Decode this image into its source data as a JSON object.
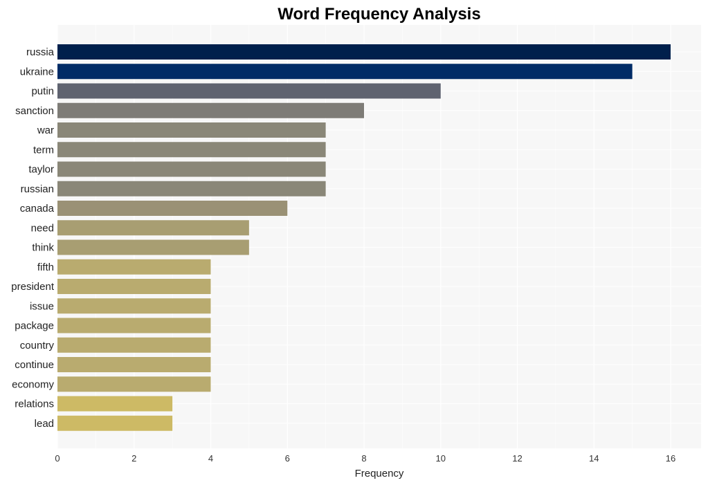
{
  "chart_data": {
    "type": "bar",
    "orientation": "horizontal",
    "title": "Word Frequency Analysis",
    "xlabel": "Frequency",
    "ylabel": "",
    "xlim": [
      0,
      16.8
    ],
    "xticks": [
      0,
      2,
      4,
      6,
      8,
      10,
      12,
      14,
      16
    ],
    "grid": true,
    "legend": "none",
    "categories": [
      "russia",
      "ukraine",
      "putin",
      "sanction",
      "war",
      "term",
      "taylor",
      "russian",
      "canada",
      "need",
      "think",
      "fifth",
      "president",
      "issue",
      "package",
      "country",
      "continue",
      "economy",
      "relations",
      "lead"
    ],
    "values": [
      16,
      15,
      10,
      8,
      7,
      7,
      7,
      7,
      6,
      5,
      5,
      4,
      4,
      4,
      4,
      4,
      4,
      4,
      3,
      3
    ],
    "colors": [
      "#00204c",
      "#002b66",
      "#5f6370",
      "#7e7c77",
      "#8a8778",
      "#8a8778",
      "#8a8778",
      "#8a8778",
      "#9a9175",
      "#a89e72",
      "#a89e72",
      "#b9ab6f",
      "#b9ab6f",
      "#b9ab6f",
      "#b9ab6f",
      "#b9ab6f",
      "#b9ab6f",
      "#b9ab6f",
      "#cdba65",
      "#cdba65"
    ],
    "background": "#f7f7f7"
  }
}
